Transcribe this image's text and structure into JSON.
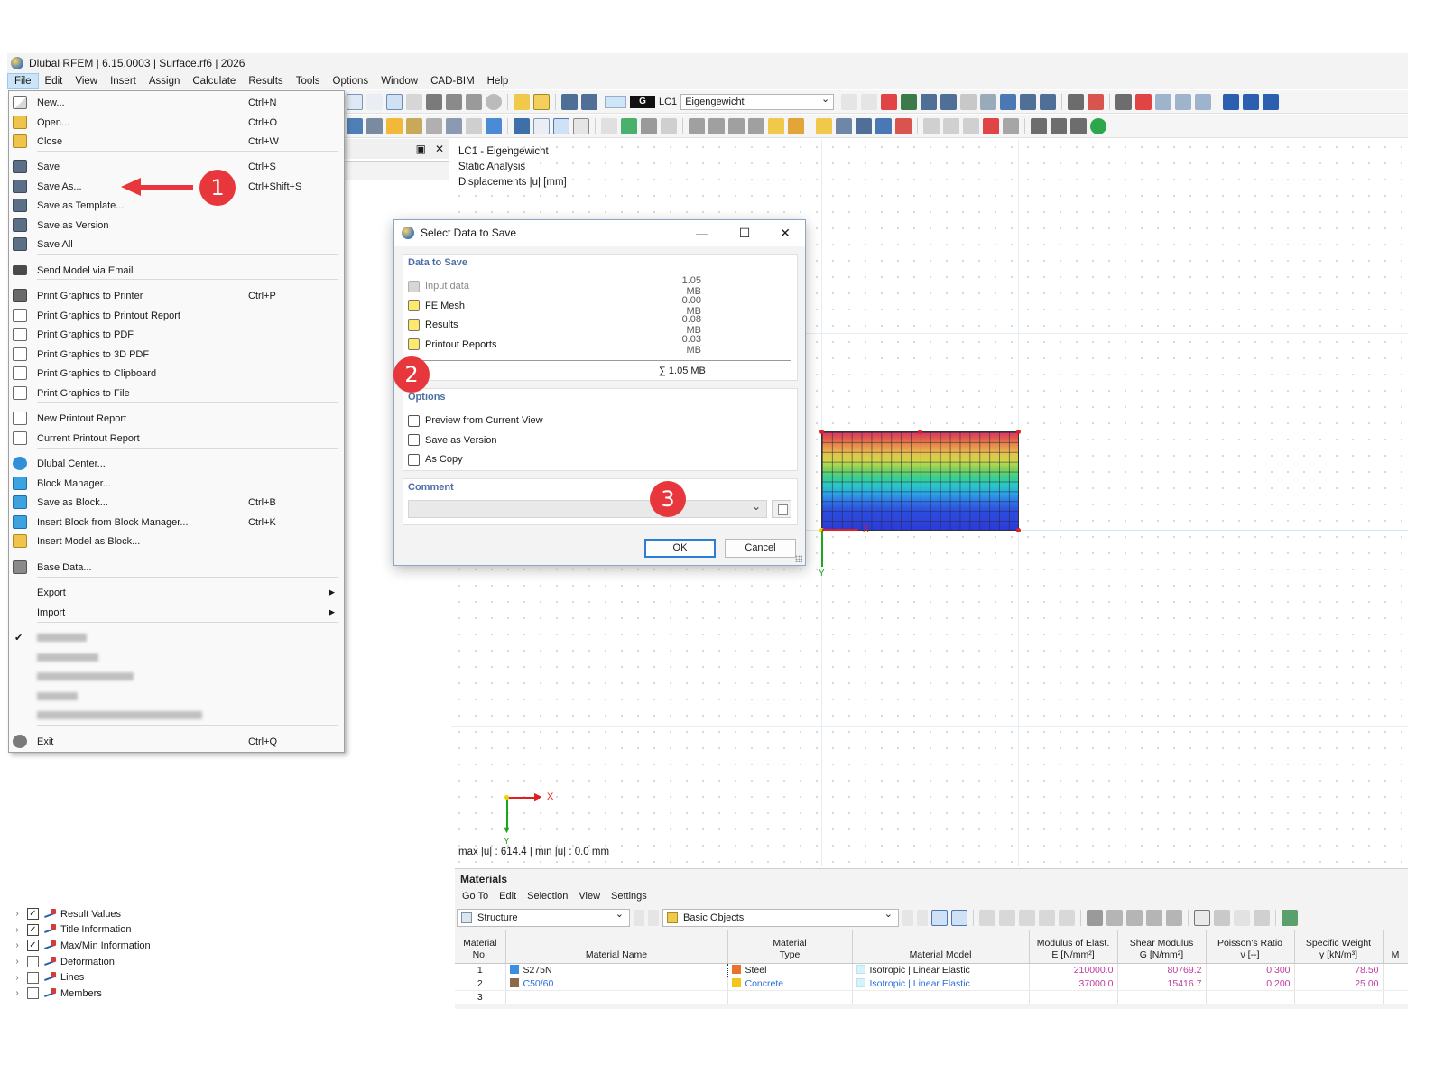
{
  "window": {
    "title": "Dlubal RFEM | 6.15.0003 | Surface.rf6 | 2026"
  },
  "menubar": [
    {
      "label": "File",
      "active": true
    },
    {
      "label": "Edit"
    },
    {
      "label": "View"
    },
    {
      "label": "Insert"
    },
    {
      "label": "Assign"
    },
    {
      "label": "Calculate"
    },
    {
      "label": "Results"
    },
    {
      "label": "Tools"
    },
    {
      "label": "Options"
    },
    {
      "label": "Window"
    },
    {
      "label": "CAD-BIM"
    },
    {
      "label": "Help"
    }
  ],
  "toolbar": {
    "loadcase_badge": "G",
    "loadcase_id": "LC1",
    "loadcase_name": "Eigengewicht"
  },
  "file_menu": {
    "items": [
      {
        "label": "New...",
        "shortcut": "Ctrl+N",
        "icon": "new-document-icon"
      },
      {
        "label": "Open...",
        "shortcut": "Ctrl+O",
        "icon": "open-folder-icon"
      },
      {
        "label": "Close",
        "shortcut": "Ctrl+W",
        "icon": "close-folder-icon"
      },
      {
        "label": "Save",
        "shortcut": "Ctrl+S",
        "icon": "save-icon"
      },
      {
        "label": "Save As...",
        "shortcut": "Ctrl+Shift+S",
        "icon": "save-as-icon"
      },
      {
        "label": "Save as Template...",
        "shortcut": "",
        "icon": "save-template-icon"
      },
      {
        "label": "Save as Version",
        "shortcut": "",
        "icon": "save-version-icon"
      },
      {
        "label": "Save All",
        "shortcut": "",
        "icon": "save-all-icon"
      },
      {
        "label": "Send Model via Email",
        "shortcut": "",
        "icon": "email-icon"
      },
      {
        "label": "Print Graphics to Printer",
        "shortcut": "Ctrl+P",
        "icon": "printer-icon"
      },
      {
        "label": "Print Graphics to Printout Report",
        "shortcut": "",
        "icon": "printout-report-icon"
      },
      {
        "label": "Print Graphics to PDF",
        "shortcut": "",
        "icon": "pdf-icon"
      },
      {
        "label": "Print Graphics to 3D PDF",
        "shortcut": "",
        "icon": "3d-pdf-icon"
      },
      {
        "label": "Print Graphics to Clipboard",
        "shortcut": "",
        "icon": "clipboard-icon"
      },
      {
        "label": "Print Graphics to File",
        "shortcut": "",
        "icon": "file-icon"
      },
      {
        "label": "New Printout Report",
        "shortcut": "",
        "icon": "new-report-icon"
      },
      {
        "label": "Current Printout Report",
        "shortcut": "",
        "icon": "current-report-icon"
      },
      {
        "label": "Dlubal Center...",
        "shortcut": "",
        "icon": "dlubal-center-icon"
      },
      {
        "label": "Block Manager...",
        "shortcut": "",
        "icon": "block-manager-icon"
      },
      {
        "label": "Save as Block...",
        "shortcut": "Ctrl+B",
        "icon": "save-block-icon"
      },
      {
        "label": "Insert Block from Block Manager...",
        "shortcut": "Ctrl+K",
        "icon": "insert-block-icon"
      },
      {
        "label": "Insert Model as Block...",
        "shortcut": "",
        "icon": "insert-model-icon"
      },
      {
        "label": "Base Data...",
        "shortcut": "",
        "icon": "base-data-icon"
      },
      {
        "label": "Export",
        "shortcut": "",
        "icon": ""
      },
      {
        "label": "Import",
        "shortcut": "",
        "icon": ""
      },
      {
        "label": "Exit",
        "shortcut": "Ctrl+Q",
        "icon": "exit-icon"
      }
    ],
    "recent_files_count": 5
  },
  "view": {
    "info_lines": [
      "LC1 - Eigengewicht",
      "Static Analysis",
      "Displacements |u| [mm]"
    ],
    "footer": "max |u| : 614.4 | min |u| : 0.0 mm",
    "axis_x": "X",
    "axis_y": "Y"
  },
  "dialog": {
    "title": "Select Data to Save",
    "data_group_title": "Data to Save",
    "data_rows": [
      {
        "label": "Input data",
        "size": "1.05 MB",
        "state": "disabled"
      },
      {
        "label": "FE Mesh",
        "size": "0.00 MB",
        "state": "yellow"
      },
      {
        "label": "Results",
        "size": "0.08 MB",
        "state": "yellow"
      },
      {
        "label": "Printout Reports",
        "size": "0.03 MB",
        "state": "yellow"
      }
    ],
    "sum": "∑ 1.05 MB",
    "options_title": "Options",
    "options": [
      {
        "label": "Preview from Current View",
        "checked": false
      },
      {
        "label": "Save as Version",
        "checked": false
      },
      {
        "label": "As Copy",
        "checked": false
      }
    ],
    "comment_title": "Comment",
    "comment_value": "",
    "ok_label": "OK",
    "cancel_label": "Cancel"
  },
  "navigator": {
    "tree": [
      {
        "label": "Result Values",
        "checked": true
      },
      {
        "label": "Title Information",
        "checked": true
      },
      {
        "label": "Max/Min Information",
        "checked": true
      },
      {
        "label": "Deformation",
        "checked": false
      },
      {
        "label": "Lines",
        "checked": false
      },
      {
        "label": "Members",
        "checked": false
      }
    ]
  },
  "materials": {
    "title": "Materials",
    "menu": [
      "Go To",
      "Edit",
      "Selection",
      "View",
      "Settings"
    ],
    "structure_combo": "Structure",
    "objects_combo": "Basic Objects",
    "columns": [
      {
        "line1": "Material",
        "line2": "No."
      },
      {
        "line1": "",
        "line2": "Material Name"
      },
      {
        "line1": "Material",
        "line2": "Type"
      },
      {
        "line1": "",
        "line2": "Material Model"
      },
      {
        "line1": "Modulus of Elast.",
        "line2": "E [N/mm²]"
      },
      {
        "line1": "Shear Modulus",
        "line2": "G [N/mm²]"
      },
      {
        "line1": "Poisson's Ratio",
        "line2": "ν [--]"
      },
      {
        "line1": "Specific Weight",
        "line2": "γ [kN/m³]"
      },
      {
        "line1": "M",
        "line2": ""
      }
    ],
    "rows": [
      {
        "no": "1",
        "name": "S275N",
        "name_color": "#3b8fe0",
        "type": "Steel",
        "type_color": "#e8742c",
        "model": "Isotropic | Linear Elastic",
        "e": "210000.0",
        "g": "80769.2",
        "nu": "0.300",
        "gamma": "78.50"
      },
      {
        "no": "2",
        "name": "C50/60",
        "name_color": "#8a6a4a",
        "type": "Concrete",
        "type_color": "#f5c518",
        "model": "Isotropic | Linear Elastic",
        "e": "37000.0",
        "g": "15416.7",
        "nu": "0.200",
        "gamma": "25.00"
      },
      {
        "no": "3",
        "name": "",
        "name_color": "",
        "type": "",
        "type_color": "",
        "model": "",
        "e": "",
        "g": "",
        "nu": "",
        "gamma": ""
      }
    ]
  },
  "annotations": [
    "1",
    "2",
    "3"
  ],
  "colors": {
    "accent": "#e8373c",
    "dialog_group_title": "#4b6fa5",
    "menu_highlight": "#cce4f7"
  }
}
